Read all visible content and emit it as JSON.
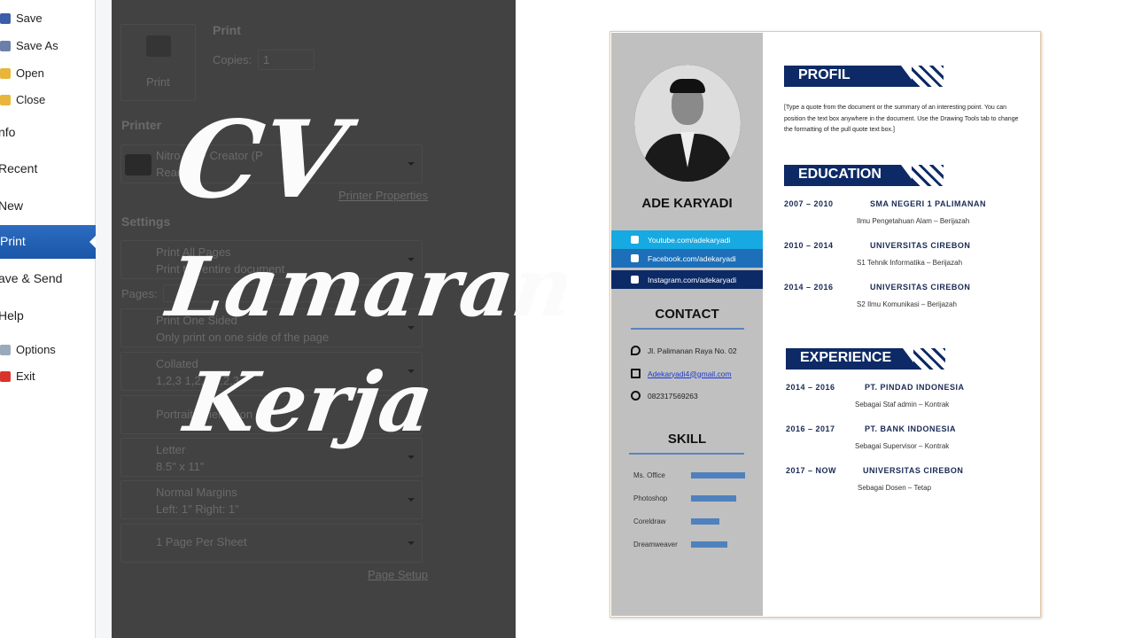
{
  "menu": {
    "items": [
      {
        "label": "Save",
        "icon": "save-icon"
      },
      {
        "label": "Save As",
        "icon": "save-as-icon"
      },
      {
        "label": "Open",
        "icon": "open-folder-icon"
      },
      {
        "label": "Close",
        "icon": "close-folder-icon"
      },
      {
        "label": "nfo"
      },
      {
        "label": "Recent"
      },
      {
        "label": "New"
      },
      {
        "label": "Print"
      },
      {
        "label": "ave & Send"
      },
      {
        "label": "Help"
      },
      {
        "label": "Options",
        "icon": "options-icon"
      },
      {
        "label": "Exit",
        "icon": "exit-icon"
      }
    ],
    "selected_color": "#1f5fb4"
  },
  "print": {
    "button_label": "Print",
    "section_title": "Print",
    "copies_label": "Copies:",
    "copies_value": "1"
  },
  "printer": {
    "title": "Printer",
    "name": "Nitro PDF Creator (P",
    "status": "Ready",
    "properties_link": "Printer Properties"
  },
  "settings": {
    "title": "Settings",
    "pages_label": "Pages:",
    "options": [
      {
        "main": "Print All Pages",
        "sub": "Print the entire document"
      },
      {
        "main": "Print One Sided",
        "sub": "Only print on one side of the page"
      },
      {
        "main": "Collated",
        "sub": "1,2,3   1,2,3   1,2,3"
      },
      {
        "main": "Portrait Orientation",
        "sub": ""
      },
      {
        "main": "Letter",
        "sub": "8.5\" x 11\""
      },
      {
        "main": "Normal Margins",
        "sub": "Left: 1\"   Right: 1\""
      },
      {
        "main": "1 Page Per Sheet",
        "sub": ""
      }
    ],
    "page_setup_link": "Page Setup"
  },
  "overlay": {
    "line1": "CV",
    "line2": "Lamaran",
    "line3": "Kerja"
  },
  "cv": {
    "name": "ADE KARYADI",
    "social": [
      {
        "label": "Youtube.com/adekaryadi",
        "color": "#17a9e1"
      },
      {
        "label": "Facebook.com/adekaryadi",
        "color": "#1c6fb8"
      },
      {
        "label": "Instagram.com/adekaryadi",
        "color": "#0c2a66"
      }
    ],
    "contact_title": "CONTACT",
    "address": "Jl. Palimanan Raya No. 02",
    "email": "Adekaryadi4@gmail.com",
    "phone": "082317569263",
    "skill_title": "SKILL",
    "skills": [
      {
        "name": "Ms. Office",
        "level": 1.0
      },
      {
        "name": "Photoshop",
        "level": 0.83
      },
      {
        "name": "Coreldraw",
        "level": 0.53
      },
      {
        "name": "Dreamweaver",
        "level": 0.68
      }
    ],
    "profil_title": "PROFIL",
    "profil_text": "[Type a quote from the document or the summary of an interesting point. You can position the text box anywhere in the document. Use the Drawing Tools tab to change the formatting of the pull quote text box.]",
    "education_title": "EDUCATION",
    "education": [
      {
        "years": "2007 – 2010",
        "institution": "SMA NEGERI 1 PALIMANAN",
        "detail": "Ilmu Pengetahuan Alam – Berijazah"
      },
      {
        "years": "2010 – 2014",
        "institution": "UNIVERSITAS CIREBON",
        "detail": "S1 Tehnik Informatika – Berijazah"
      },
      {
        "years": "2014 – 2016",
        "institution": "UNIVERSITAS CIREBON",
        "detail": "S2 Ilmu Komunikasi – Berijazah"
      }
    ],
    "experience_title": "EXPERIENCE",
    "experience": [
      {
        "years": "2014 – 2016",
        "institution": "PT. PINDAD INDONESIA",
        "detail": "Sebagai Staf admin – Kontrak"
      },
      {
        "years": "2016 – 2017",
        "institution": "PT. BANK INDONESIA",
        "detail": "Sebagai Supervisor – Kontrak"
      },
      {
        "years": "2017 – NOW",
        "institution": "UNIVERSITAS CIREBON",
        "detail": "Sebagai Dosen – Tetap"
      }
    ]
  }
}
